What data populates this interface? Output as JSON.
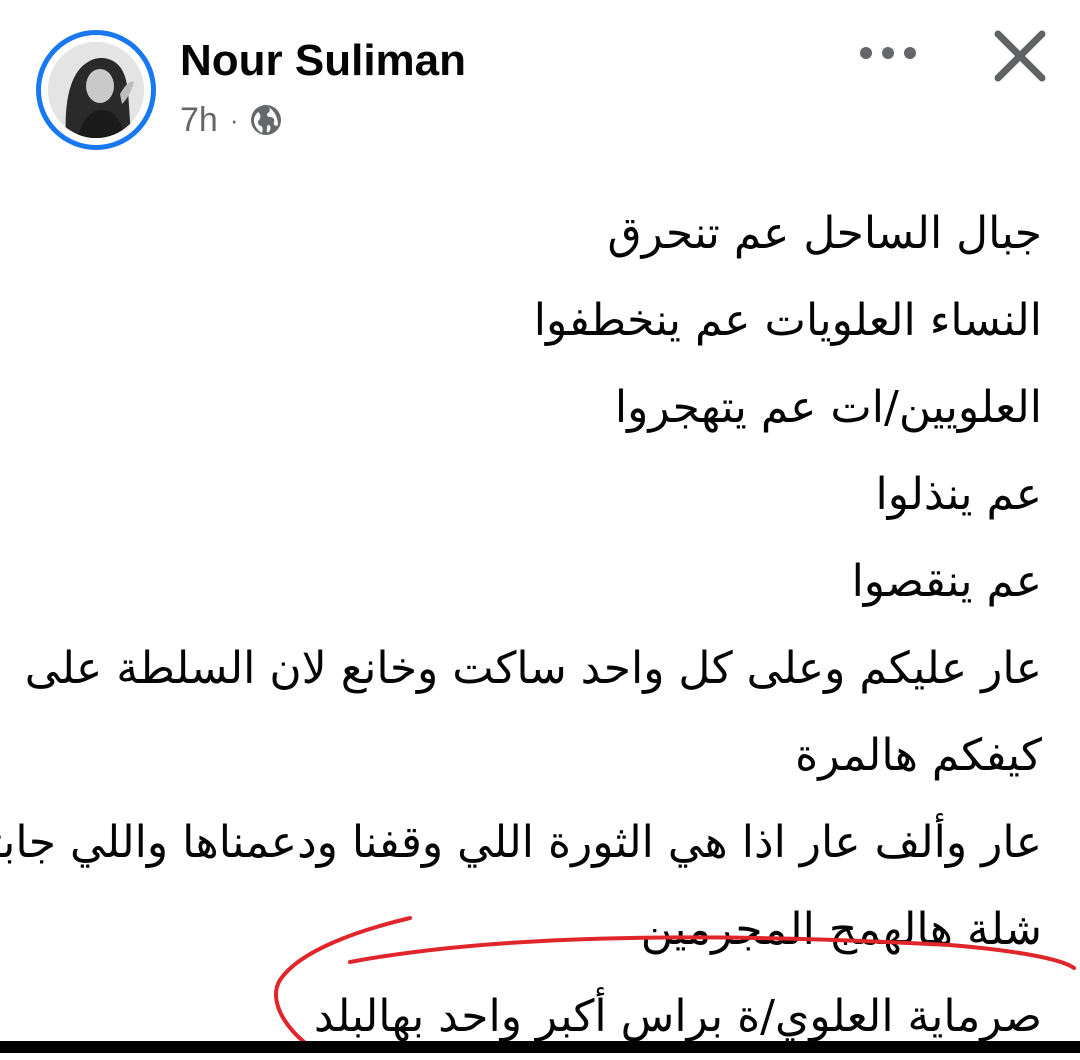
{
  "post": {
    "author": "Nour Suliman",
    "time": "7h",
    "separator": "·",
    "audience_icon": "globe-icon",
    "avatar_ring_color": "#1877f2",
    "lines": [
      "جبال الساحل عم تنحرق",
      "النساء العلويات عم ينخطفوا",
      "العلويين/ات عم يتهجروا",
      "عم ينذلوا",
      "عم ينقصوا",
      "عار عليكم وعلى كل واحد ساكت وخانع لان السلطة على",
      "كيفكم هالمرة",
      "عار وألف عار اذا هي الثورة اللي وقفنا ودعمناها واللي جابتلنا",
      "شلة هالهمج المجرمين",
      "صرماية العلوي/ة براس أكبر واحد بهالبلد"
    ]
  },
  "toolbar": {
    "more_icon": "more-horizontal-icon",
    "close_icon": "close-icon"
  },
  "annotation": {
    "color": "#e0252b"
  }
}
